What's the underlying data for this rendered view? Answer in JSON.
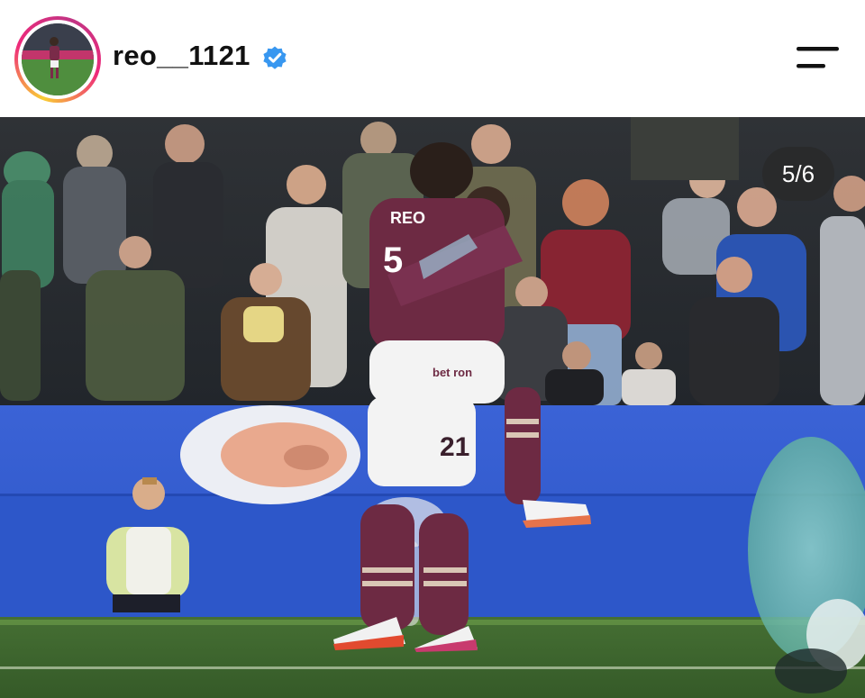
{
  "header": {
    "username": "reo__1121",
    "verified": true,
    "verified_icon": "verified-badge-icon",
    "menu_icon": "menu-icon"
  },
  "post": {
    "counter": "5/6",
    "jersey_front_number": "5",
    "jersey_front_name": "REO",
    "jersey_back_number": "21",
    "sponsor": "bet ron"
  },
  "colors": {
    "ring_gradient": [
      "#f9ce34",
      "#ee2a7b",
      "#c13584"
    ],
    "verified_blue": "#3897f0",
    "kit_claret": "#6d2a43",
    "pitch_green": "#3a6a2e",
    "board_blue": "#2f59cf"
  }
}
